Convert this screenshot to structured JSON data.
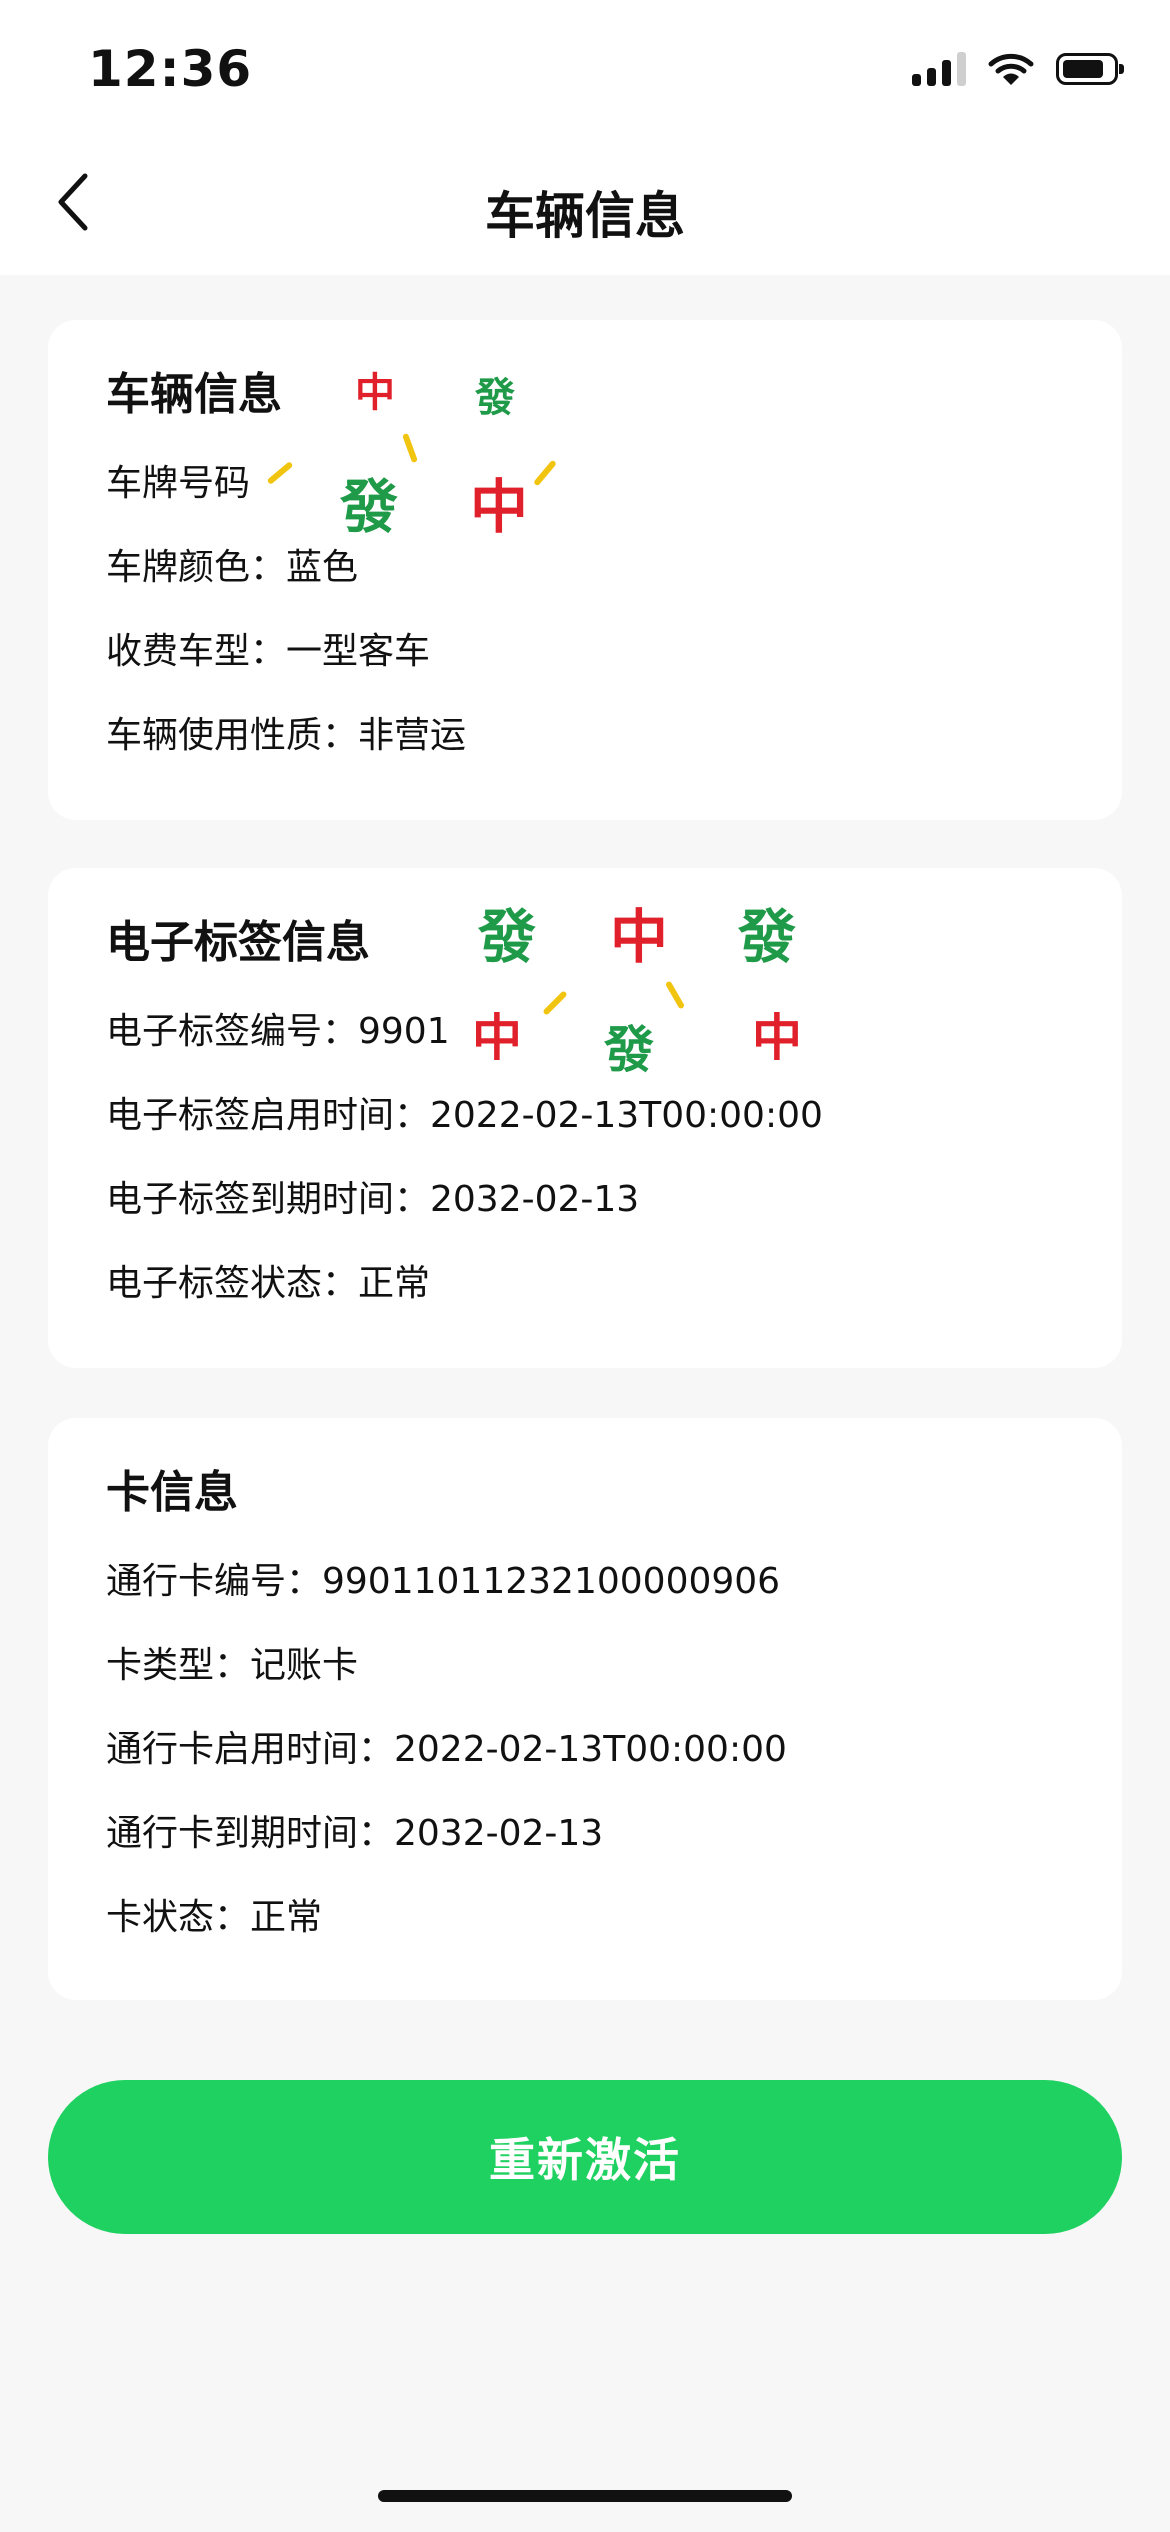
{
  "status_bar": {
    "time": "12:36"
  },
  "nav": {
    "title": "车辆信息"
  },
  "vehicle": {
    "title": "车辆信息",
    "plate_number": "车牌号码",
    "plate_color": "车牌颜色：蓝色",
    "toll_type": "收费车型：一型客车",
    "usage": "车辆使用性质：非营运"
  },
  "etag": {
    "title": "电子标签信息",
    "number": "电子标签编号：9901",
    "start": "电子标签启用时间：2022-02-13T00:00:00",
    "expire": "电子标签到期时间：2032-02-13",
    "status": "电子标签状态：正常"
  },
  "card": {
    "title": "卡信息",
    "number": "通行卡编号：99011011232100000906",
    "type": "卡类型：记账卡",
    "start": "通行卡启用时间：2022-02-13T00:00:00",
    "expire": "通行卡到期时间：2032-02-13",
    "status": "卡状态：正常"
  },
  "action": {
    "reactivate_label": "重新激活"
  },
  "watermark": {
    "fa": "發",
    "zhong": "中"
  }
}
